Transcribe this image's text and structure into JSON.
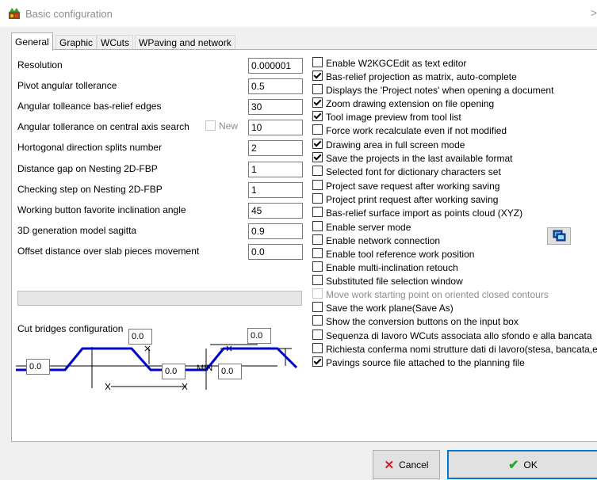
{
  "window": {
    "title": "Basic configuration",
    "close_glyph": ">"
  },
  "tabs": [
    {
      "label": "General",
      "active": true
    },
    {
      "label": "Graphic",
      "active": false
    },
    {
      "label": "WCuts",
      "active": false
    },
    {
      "label": "WPaving and network",
      "active": false
    }
  ],
  "params": [
    {
      "label": "Resolution",
      "value": "0.000001"
    },
    {
      "label": "Pivot angular tollerance",
      "value": "0.5"
    },
    {
      "label": "Angular tolleance bas-relief edges",
      "value": "30"
    },
    {
      "label": "Angular tollerance on central axis search",
      "value": "10"
    },
    {
      "label": "Hortogonal direction splits number",
      "value": "2"
    },
    {
      "label": "Distance gap on Nesting 2D-FBP",
      "value": "1"
    },
    {
      "label": "Checking step on Nesting 2D-FBP",
      "value": "1"
    },
    {
      "label": "Working button favorite inclination angle",
      "value": "45"
    },
    {
      "label": "3D generation model sagitta",
      "value": "0.9"
    },
    {
      "label": "Offset distance over slab pieces movement",
      "value": "0.0"
    }
  ],
  "new_option": {
    "label": "New",
    "checked": false
  },
  "progress": {
    "fraction": 0.0
  },
  "cut_bridges": {
    "label": "Cut bridges configuration",
    "min_label": "MIN",
    "values": [
      "0.0",
      "0.0",
      "0.0",
      "0.0",
      "0.0"
    ]
  },
  "options": [
    {
      "label": "Enable W2KGCEdit as text editor",
      "checked": false,
      "disabled": false
    },
    {
      "label": "Bas-relief projection as matrix, auto-complete",
      "checked": true,
      "disabled": false
    },
    {
      "label": "Displays the 'Project notes' when opening a document",
      "checked": false,
      "disabled": false
    },
    {
      "label": "Zoom drawing extension on file opening",
      "checked": true,
      "disabled": false
    },
    {
      "label": "Tool image preview from tool list",
      "checked": true,
      "disabled": false
    },
    {
      "label": "Force work recalculate even if not modified",
      "checked": false,
      "disabled": false
    },
    {
      "label": "Drawing area in full screen mode",
      "checked": true,
      "disabled": false
    },
    {
      "label": "Save the projects in the last available format",
      "checked": true,
      "disabled": false
    },
    {
      "label": "Selected font for dictionary characters set",
      "checked": false,
      "disabled": false
    },
    {
      "label": "Project save request after working saving",
      "checked": false,
      "disabled": false
    },
    {
      "label": "Project print request after working saving",
      "checked": false,
      "disabled": false
    },
    {
      "label": "Bas-relief surface import as points cloud (XYZ)",
      "checked": false,
      "disabled": false
    },
    {
      "label": "Enable server mode",
      "checked": false,
      "disabled": false
    },
    {
      "label": "Enable network connection",
      "checked": false,
      "disabled": false
    },
    {
      "label": "Enable tool reference work position",
      "checked": false,
      "disabled": false
    },
    {
      "label": "Enable multi-inclination retouch",
      "checked": false,
      "disabled": false
    },
    {
      "label": "Substituted file selection window",
      "checked": false,
      "disabled": false
    },
    {
      "label": "Move work starting point on oriented closed contours",
      "checked": false,
      "disabled": true
    },
    {
      "label": "Save the work plane(Save As)",
      "checked": false,
      "disabled": false
    },
    {
      "label": "Show the conversion buttons on the input box",
      "checked": false,
      "disabled": false
    },
    {
      "label": "Sequenza di lavoro WCuts associata allo sfondo e alla bancata",
      "checked": false,
      "disabled": false
    },
    {
      "label": "Richiesta conferma nomi strutture dati di lavoro(stesa, bancata,ecc",
      "checked": false,
      "disabled": false
    },
    {
      "label": "Pavings source file attached to the planning file",
      "checked": true,
      "disabled": false
    }
  ],
  "buttons": {
    "cancel": "Cancel",
    "ok": "OK"
  },
  "colors": {
    "accent": "#0078d7",
    "diagram_line": "#0000d0",
    "cancel_icon": "#e81123",
    "ok_icon": "#2aa52a"
  }
}
